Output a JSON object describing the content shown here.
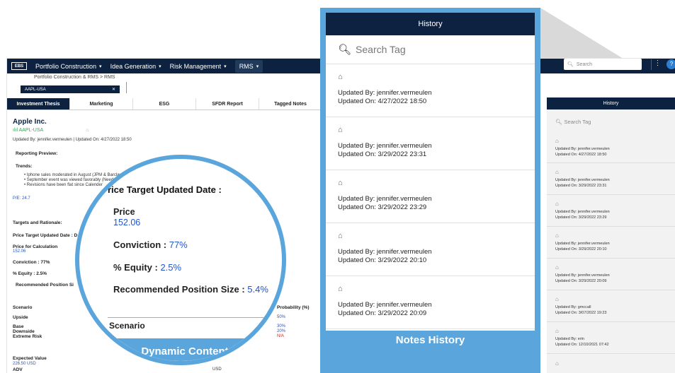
{
  "app": {
    "logo": "EBS",
    "nav": [
      {
        "label": "Portfolio Construction"
      },
      {
        "label": "Idea Generation"
      },
      {
        "label": "Risk Management"
      },
      {
        "label": "RMS"
      }
    ],
    "breadcrumb": "Portfolio Construction & RMS > RMS",
    "chip": "AAPL-USA",
    "tabs": [
      "Investment Thesis",
      "Marketing",
      "ESG",
      "SFDR Report",
      "Tagged Notes"
    ],
    "search_placeholder": "Search",
    "company": "Apple Inc.",
    "ticker": "AAPL-USA",
    "updated_line": "Updated By: jennifer.vermeulen | Updated On: 4/27/2022 18:50",
    "reporting_preview": "Reporting Preview:",
    "trends_label": "Trends:",
    "trends": [
      "Iphone sales moderated in August (JPM & Barclays)",
      "September event was viewed favorably (Need",
      "Revisions have been flat since Calender"
    ],
    "pe": "P/E: 24.7",
    "targets": "Targets and Rationale:",
    "price_target_date": "Price Target Updated Date : D",
    "price_calc_label": "Price for Calculation",
    "price_calc_value": "152.06",
    "conviction": "Conviction : 77%",
    "equity": "% Equity : 2.5%",
    "rec_pos": "Recommended Position Si",
    "scenario_header": "Scenario",
    "probability_header": "Probability (%)",
    "scenarios": [
      "Upside",
      "Base",
      "Downside",
      "Extreme Risk"
    ],
    "probabilities": [
      "50%",
      "30%",
      "20%",
      "N/A"
    ],
    "expected_value_label": "Expected Value",
    "expected_value": "226.50 USD",
    "adv": "ADV",
    "adv_value": "USD"
  },
  "magnifier": {
    "title": "rice Target Updated Date :",
    "price_label": "Price",
    "price_value": "152.06",
    "conviction_label": "Conviction : ",
    "conviction_value": "77%",
    "equity_label": "% Equity : ",
    "equity_value": "2.5%",
    "rec_label": "Recommended Position Size : ",
    "rec_value": "5.4%",
    "scenario": "Scenario",
    "banner": "Dynamic Content"
  },
  "history": {
    "title": "History",
    "search_placeholder": "Search Tag",
    "entries": [
      {
        "by": "Updated By: jennifer.vermeulen",
        "on": "Updated On: 4/27/2022 18:50"
      },
      {
        "by": "Updated By: jennifer.vermeulen",
        "on": "Updated On: 3/29/2022 23:31"
      },
      {
        "by": "Updated By: jennifer.vermeulen",
        "on": "Updated On: 3/29/2022 23:29"
      },
      {
        "by": "Updated By: jennifer.vermeulen",
        "on": "Updated On: 3/29/2022 20:10"
      },
      {
        "by": "Updated By: jennifer.vermeulen",
        "on": "Updated On: 3/29/2022 20:09"
      }
    ],
    "banner": "Notes History"
  },
  "mini_history": {
    "title": "History",
    "search_placeholder": "Search Tag",
    "entries": [
      {
        "by": "Updated By: jennifer.vermeulen",
        "on": "Updated On: 4/27/2022 18:50"
      },
      {
        "by": "Updated By: jennifer.vermeulen",
        "on": "Updated On: 3/29/2022 23:31"
      },
      {
        "by": "Updated By: jennifer.vermeulen",
        "on": "Updated On: 3/29/2022 23:29"
      },
      {
        "by": "Updated By: jennifer.vermeulen",
        "on": "Updated On: 3/29/2022 20:10"
      },
      {
        "by": "Updated By: jennifer.vermeulen",
        "on": "Updated On: 3/29/2022 20:09"
      },
      {
        "by": "Updated By: gmccall",
        "on": "Updated On: 3/07/2022 19:23"
      },
      {
        "by": "Updated By: erin",
        "on": "Updated On: 12/10/2021 07:42"
      }
    ]
  },
  "colors": {
    "navy": "#0c2240",
    "accent_blue": "#5aa6dc",
    "link_blue": "#2255cc",
    "green": "#3aa35a"
  }
}
